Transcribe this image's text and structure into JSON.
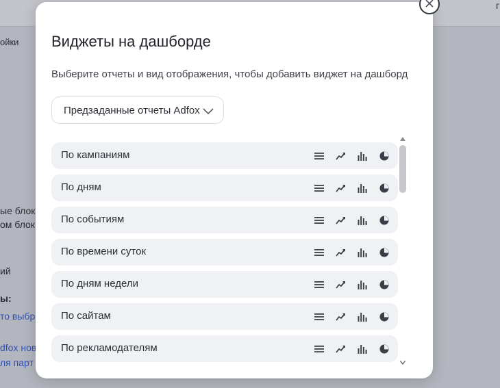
{
  "background": {
    "topbar_right": "г",
    "breadcrumb": "ойки",
    "fragments": [
      "ые блоки",
      "ом блок",
      "ий",
      "ы:",
      "то выбр",
      "dfox нов",
      "ля парт"
    ]
  },
  "modal": {
    "title": "Виджеты на дашборде",
    "description": "Выберите отчеты и вид отображения, чтобы добавить виджет на дашборд",
    "dropdown_value": "Предзаданные отчеты Adfox",
    "close_icon": "close-icon",
    "reports": [
      {
        "label": "По кампаниям"
      },
      {
        "label": "По дням"
      },
      {
        "label": "По событиям"
      },
      {
        "label": "По времени суток"
      },
      {
        "label": "По дням недели"
      },
      {
        "label": "По сайтам"
      },
      {
        "label": "По рекламодателям"
      }
    ],
    "view_icons": [
      "table-icon",
      "line-chart-icon",
      "bar-chart-icon",
      "pie-chart-icon"
    ]
  }
}
